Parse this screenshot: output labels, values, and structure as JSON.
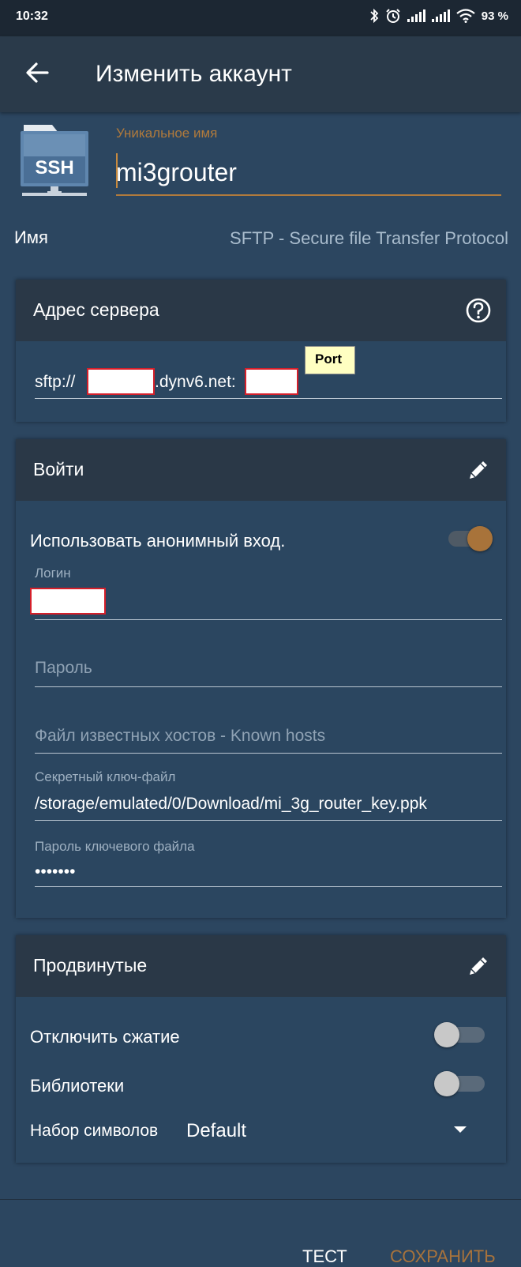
{
  "status_bar": {
    "time": "10:32",
    "battery": "93 %"
  },
  "toolbar": {
    "title": "Изменить аккаунт"
  },
  "header": {
    "unique_name_label": "Уникальное имя",
    "unique_name_value": "mi3grouter",
    "icon_text": "SSH",
    "name_label": "Имя",
    "name_value": "SFTP - Secure file Transfer Protocol"
  },
  "server_card": {
    "title": "Адрес сервера",
    "address_prefix": "sftp://",
    "address_middle": ".dynv6.net:",
    "tooltip": "Port"
  },
  "login_card": {
    "title": "Войти",
    "anonymous_label": "Использовать анонимный вход.",
    "anonymous_enabled": true,
    "login_label": "Логин",
    "password_placeholder": "Пароль",
    "known_hosts_placeholder": "Файл известных хостов - Known hosts",
    "key_file_label": "Секретный ключ-файл",
    "key_file_value": "/storage/emulated/0/Download/mi_3g_router_key.ppk",
    "key_password_label": "Пароль ключевого файла",
    "key_password_value": "•••••••"
  },
  "advanced_card": {
    "title": "Продвинутые",
    "disable_compression_label": "Отключить сжатие",
    "disable_compression_enabled": false,
    "libraries_label": "Библиотеки",
    "libraries_enabled": false,
    "charset_label": "Набор символов",
    "charset_value": "Default"
  },
  "actions": {
    "test_label": "ТЕСТ",
    "save_label": "СОХРАНИТЬ"
  },
  "colors": {
    "background": "#2c4660",
    "toolbar": "#2a3a4a",
    "accent": "#b07a3c",
    "switch_on_thumb": "#a8733a",
    "switch_off_thumb": "#c8c8c8"
  }
}
